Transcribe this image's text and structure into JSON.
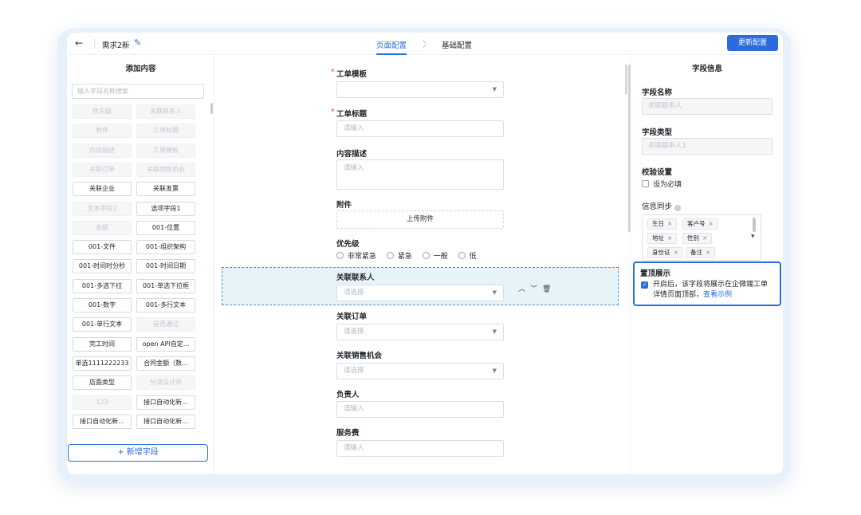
{
  "header": {
    "title": "需求2新",
    "tabs": [
      "页面配置",
      "基础配置"
    ],
    "update_button": "更新配置"
  },
  "left_panel": {
    "title": "添加内容",
    "search_placeholder": "输入字段名称搜索",
    "fields": [
      {
        "label": "优先级",
        "disabled": true
      },
      {
        "label": "关联联系人",
        "disabled": true
      },
      {
        "label": "附件",
        "disabled": true
      },
      {
        "label": "工单标题",
        "disabled": true
      },
      {
        "label": "内容描述",
        "disabled": true
      },
      {
        "label": "工单模板",
        "disabled": true
      },
      {
        "label": "关联订单",
        "disabled": true
      },
      {
        "label": "关联销售机会",
        "disabled": true
      },
      {
        "label": "关联企业",
        "disabled": false
      },
      {
        "label": "关联发票",
        "disabled": false
      },
      {
        "label": "文本字段2",
        "disabled": true
      },
      {
        "label": "选项字段1",
        "disabled": false
      },
      {
        "label": "金额",
        "disabled": true
      },
      {
        "label": "001-位置",
        "disabled": false
      },
      {
        "label": "001-文件",
        "disabled": false
      },
      {
        "label": "001-组织架构",
        "disabled": false
      },
      {
        "label": "001-时间时分秒",
        "disabled": false
      },
      {
        "label": "001-时间日期",
        "disabled": false
      },
      {
        "label": "001-多选下拉",
        "disabled": false
      },
      {
        "label": "001-单选下拉框",
        "disabled": false
      },
      {
        "label": "001-数字",
        "disabled": false
      },
      {
        "label": "001-多行文本",
        "disabled": false
      },
      {
        "label": "001-单行文本",
        "disabled": false
      },
      {
        "label": "是否通过",
        "disabled": true
      },
      {
        "label": "完工时间",
        "disabled": false
      },
      {
        "label": "open API自定...",
        "disabled": false
      },
      {
        "label": "单选1111222233",
        "disabled": false
      },
      {
        "label": "合同金额（数...",
        "disabled": false
      },
      {
        "label": "店面类型",
        "disabled": false
      },
      {
        "label": "分派设计师",
        "disabled": true
      },
      {
        "label": "123",
        "disabled": true
      },
      {
        "label": "接口自动化新...",
        "disabled": false
      },
      {
        "label": "接口自动化新...",
        "disabled": false
      },
      {
        "label": "接口自动化新...",
        "disabled": false
      }
    ],
    "add_button": "+ 新增字段"
  },
  "form": {
    "template_label": "工单模板",
    "title_label": "工单标题",
    "title_placeholder": "请输入",
    "desc_label": "内容描述",
    "desc_placeholder": "请输入",
    "attach_label": "附件",
    "upload_label": "上传附件",
    "priority_label": "优先级",
    "priority_options": [
      "非常紧急",
      "紧急",
      "一般",
      "低"
    ],
    "contact_label": "关联联系人",
    "contact_placeholder": "请选择",
    "order_label": "关联订单",
    "order_placeholder": "请选择",
    "opportunity_label": "关联销售机会",
    "opportunity_placeholder": "请选择",
    "owner_label": "负责人",
    "owner_placeholder": "请输入",
    "fee_label": "服务费",
    "fee_placeholder": "请输入"
  },
  "right_panel": {
    "title": "字段信息",
    "name_label": "字段名称",
    "name_value": "关联联系人",
    "type_label": "字段类型",
    "type_value": "关联联系人1",
    "validate_label": "校验设置",
    "required_label": "设为必填",
    "sync_label": "信息同步",
    "sync_tags": [
      "生日",
      "客户号",
      "地址",
      "性别",
      "身份证",
      "备注"
    ],
    "pin_title": "置顶展示",
    "pin_text": "开启后，该字段将展示在企微端工单详情页面顶部，",
    "pin_link": "查看示例"
  }
}
